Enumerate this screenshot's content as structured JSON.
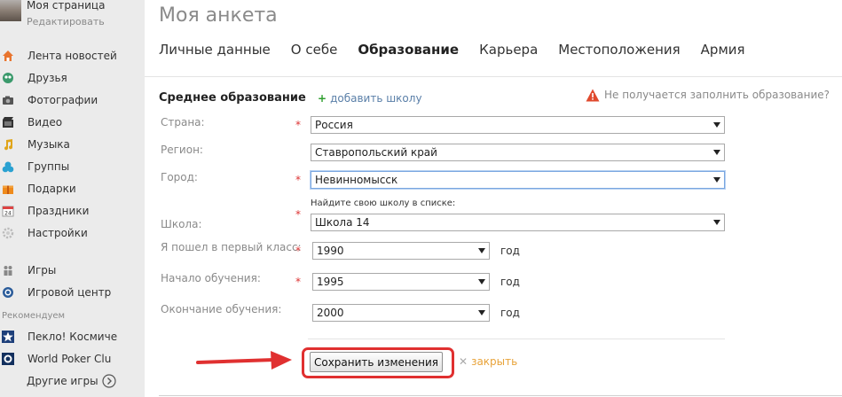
{
  "profile": {
    "name": "Моя страница",
    "edit": "Редактировать"
  },
  "sidebar": {
    "items": [
      {
        "label": "Лента новостей",
        "icon": "house-icon"
      },
      {
        "label": "Друзья",
        "icon": "friends-icon"
      },
      {
        "label": "Фотографии",
        "icon": "camera-icon"
      },
      {
        "label": "Видео",
        "icon": "film-icon"
      },
      {
        "label": "Музыка",
        "icon": "music-note-icon"
      },
      {
        "label": "Группы",
        "icon": "groups-icon"
      },
      {
        "label": "Подарки",
        "icon": "gift-icon"
      },
      {
        "label": "Праздники",
        "icon": "calendar-icon"
      },
      {
        "label": "Настройки",
        "icon": "gear-icon"
      }
    ],
    "games": [
      {
        "label": "Игры",
        "icon": "games-icon"
      },
      {
        "label": "Игровой центр",
        "icon": "game-center-icon"
      }
    ],
    "recommended_label": "Рекомендуем",
    "recommended": [
      {
        "label": "Пекло! Космиче",
        "icon": "star-icon"
      },
      {
        "label": "World Poker Clu",
        "icon": "poker-icon"
      },
      {
        "label": "Другие игры",
        "icon": "arrow-circle-icon"
      }
    ]
  },
  "header": {
    "title": "Моя анкета",
    "tabs": [
      {
        "label": "Личные данные",
        "active": false
      },
      {
        "label": "О себе",
        "active": false
      },
      {
        "label": "Образование",
        "active": true
      },
      {
        "label": "Карьера",
        "active": false
      },
      {
        "label": "Местоположения",
        "active": false
      },
      {
        "label": "Армия",
        "active": false
      }
    ]
  },
  "form": {
    "section_title": "Среднее образование",
    "add_school": "добавить школу",
    "help": "Не получается заполнить образование?",
    "country": {
      "label": "Страна:",
      "value": "Россия",
      "required": "*"
    },
    "region": {
      "label": "Регион:",
      "value": "Ставропольский край"
    },
    "city": {
      "label": "Город:",
      "value": "Невинномысск",
      "required": "*"
    },
    "school_hint": "Найдите свою школу в списке:",
    "school": {
      "label": "Школа:",
      "value": "Школа 14",
      "required": "*"
    },
    "first_grade": {
      "label": "Я пошел в первый класс:",
      "value": "1990",
      "required": "*",
      "unit": "год"
    },
    "study_start": {
      "label": "Начало обучения:",
      "value": "1995",
      "required": "*",
      "unit": "год"
    },
    "study_end": {
      "label": "Окончание обучения:",
      "value": "2000",
      "unit": "год"
    },
    "save_button": "Сохранить изменения",
    "close_link": "закрыть"
  },
  "colors": {
    "highlight": "#e03030",
    "link": "#5a7fa8",
    "close": "#e8a33a",
    "required": "#d33333"
  }
}
